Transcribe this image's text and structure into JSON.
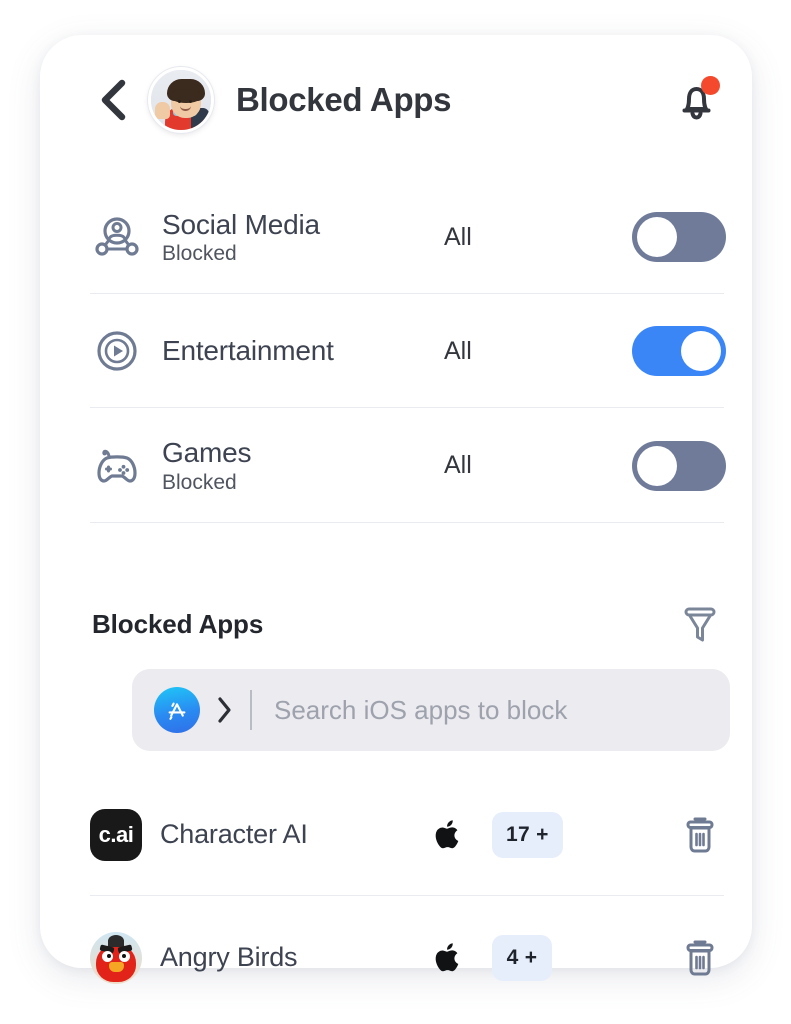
{
  "header": {
    "back_icon": "chevron-left-icon",
    "avatar_alt": "child-profile-photo",
    "title": "Blocked Apps",
    "bell_icon": "bell-icon",
    "bell_badge": "",
    "badge_color": "#f4492d"
  },
  "categories": [
    {
      "icon": "social-network-icon",
      "name": "Social Media",
      "status": "Blocked",
      "scope": "All",
      "toggle_on": false
    },
    {
      "icon": "play-circle-icon",
      "name": "Entertainment",
      "status": "",
      "scope": "All",
      "toggle_on": true
    },
    {
      "icon": "gamepad-icon",
      "name": "Games",
      "status": "Blocked",
      "scope": "All",
      "toggle_on": false
    }
  ],
  "section": {
    "title": "Blocked Apps",
    "filter_icon": "filter-funnel-icon"
  },
  "search": {
    "store_icon": "app-store-icon",
    "chevron_icon": "chevron-right-icon",
    "placeholder": "Search iOS apps to block",
    "value": ""
  },
  "apps": [
    {
      "icon": "character-ai-app-icon",
      "icon_text": "c.ai",
      "name": "Character AI",
      "platform_icon": "apple-logo-icon",
      "age_rating": "17 +",
      "delete_icon": "trash-icon"
    },
    {
      "icon": "angry-birds-app-icon",
      "icon_text": "",
      "name": "Angry Birds",
      "platform_icon": "apple-logo-icon",
      "age_rating": "4 +",
      "delete_icon": "trash-icon"
    }
  ],
  "colors": {
    "toggle_on": "#3b86f7",
    "toggle_off": "#6f7b99",
    "badge_bg": "#e6eefc",
    "icon_gray": "#6f7b93",
    "search_bg": "#ebebf0"
  }
}
